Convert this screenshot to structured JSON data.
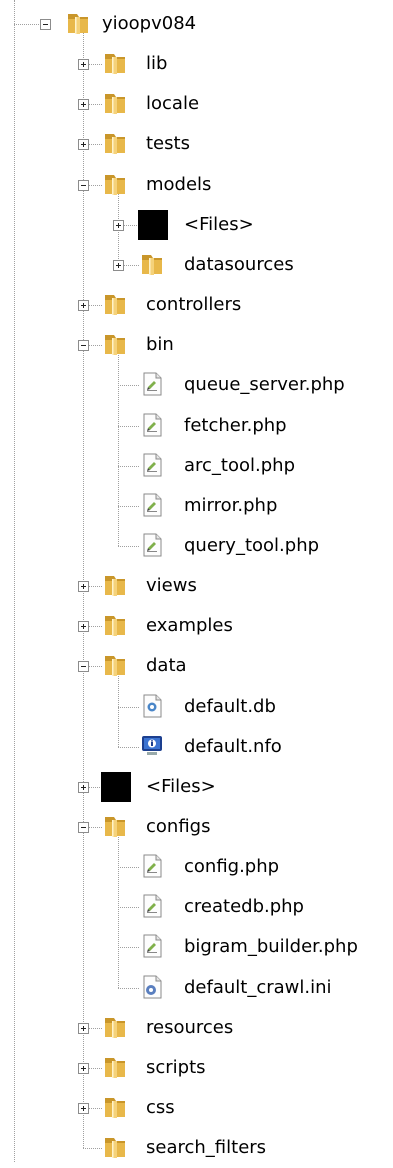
{
  "tree": {
    "root": "yioopv084",
    "items": [
      {
        "label": "yioopv084",
        "icon": "folder",
        "expander": "minus",
        "depth": 0
      },
      {
        "label": "lib",
        "icon": "folder",
        "expander": "plus",
        "depth": 1
      },
      {
        "label": "locale",
        "icon": "folder",
        "expander": "plus",
        "depth": 1
      },
      {
        "label": "tests",
        "icon": "folder",
        "expander": "plus",
        "depth": 1
      },
      {
        "label": "models",
        "icon": "folder",
        "expander": "minus",
        "depth": 1
      },
      {
        "label": "<Files>",
        "icon": "redacted-block",
        "expander": "plus",
        "depth": 2
      },
      {
        "label": "datasources",
        "icon": "folder",
        "expander": "plus",
        "depth": 2
      },
      {
        "label": "controllers",
        "icon": "folder",
        "expander": "plus",
        "depth": 1
      },
      {
        "label": "bin",
        "icon": "folder",
        "expander": "minus",
        "depth": 1
      },
      {
        "label": "queue_server.php",
        "icon": "php-file",
        "expander": "none",
        "depth": 2
      },
      {
        "label": "fetcher.php",
        "icon": "php-file",
        "expander": "none",
        "depth": 2
      },
      {
        "label": "arc_tool.php",
        "icon": "php-file",
        "expander": "none",
        "depth": 2
      },
      {
        "label": "mirror.php",
        "icon": "php-file",
        "expander": "none",
        "depth": 2
      },
      {
        "label": "query_tool.php",
        "icon": "php-file",
        "expander": "none",
        "depth": 2
      },
      {
        "label": "views",
        "icon": "folder",
        "expander": "plus",
        "depth": 1
      },
      {
        "label": "examples",
        "icon": "folder",
        "expander": "plus",
        "depth": 1
      },
      {
        "label": "data",
        "icon": "folder",
        "expander": "minus",
        "depth": 1
      },
      {
        "label": "default.db",
        "icon": "db-file",
        "expander": "none",
        "depth": 2
      },
      {
        "label": "default.nfo",
        "icon": "info-file",
        "expander": "none",
        "depth": 2
      },
      {
        "label": "<Files>",
        "icon": "redacted-block",
        "expander": "plus",
        "depth": 1
      },
      {
        "label": "configs",
        "icon": "folder",
        "expander": "minus",
        "depth": 1
      },
      {
        "label": "config.php",
        "icon": "php-file",
        "expander": "none",
        "depth": 2
      },
      {
        "label": "createdb.php",
        "icon": "php-file",
        "expander": "none",
        "depth": 2
      },
      {
        "label": "bigram_builder.php",
        "icon": "php-file",
        "expander": "none",
        "depth": 2
      },
      {
        "label": "default_crawl.ini",
        "icon": "ini-file",
        "expander": "none",
        "depth": 2
      },
      {
        "label": "resources",
        "icon": "folder",
        "expander": "plus",
        "depth": 1
      },
      {
        "label": "scripts",
        "icon": "folder",
        "expander": "plus",
        "depth": 1
      },
      {
        "label": "css",
        "icon": "folder",
        "expander": "plus",
        "depth": 1
      },
      {
        "label": "search_filters",
        "icon": "folder",
        "expander": "none",
        "depth": 1
      }
    ]
  },
  "colors": {
    "folder": "#e8b84a",
    "folder_dark": "#c9962a",
    "tree_line": "#a0a0a0",
    "background": "#ffffff"
  }
}
